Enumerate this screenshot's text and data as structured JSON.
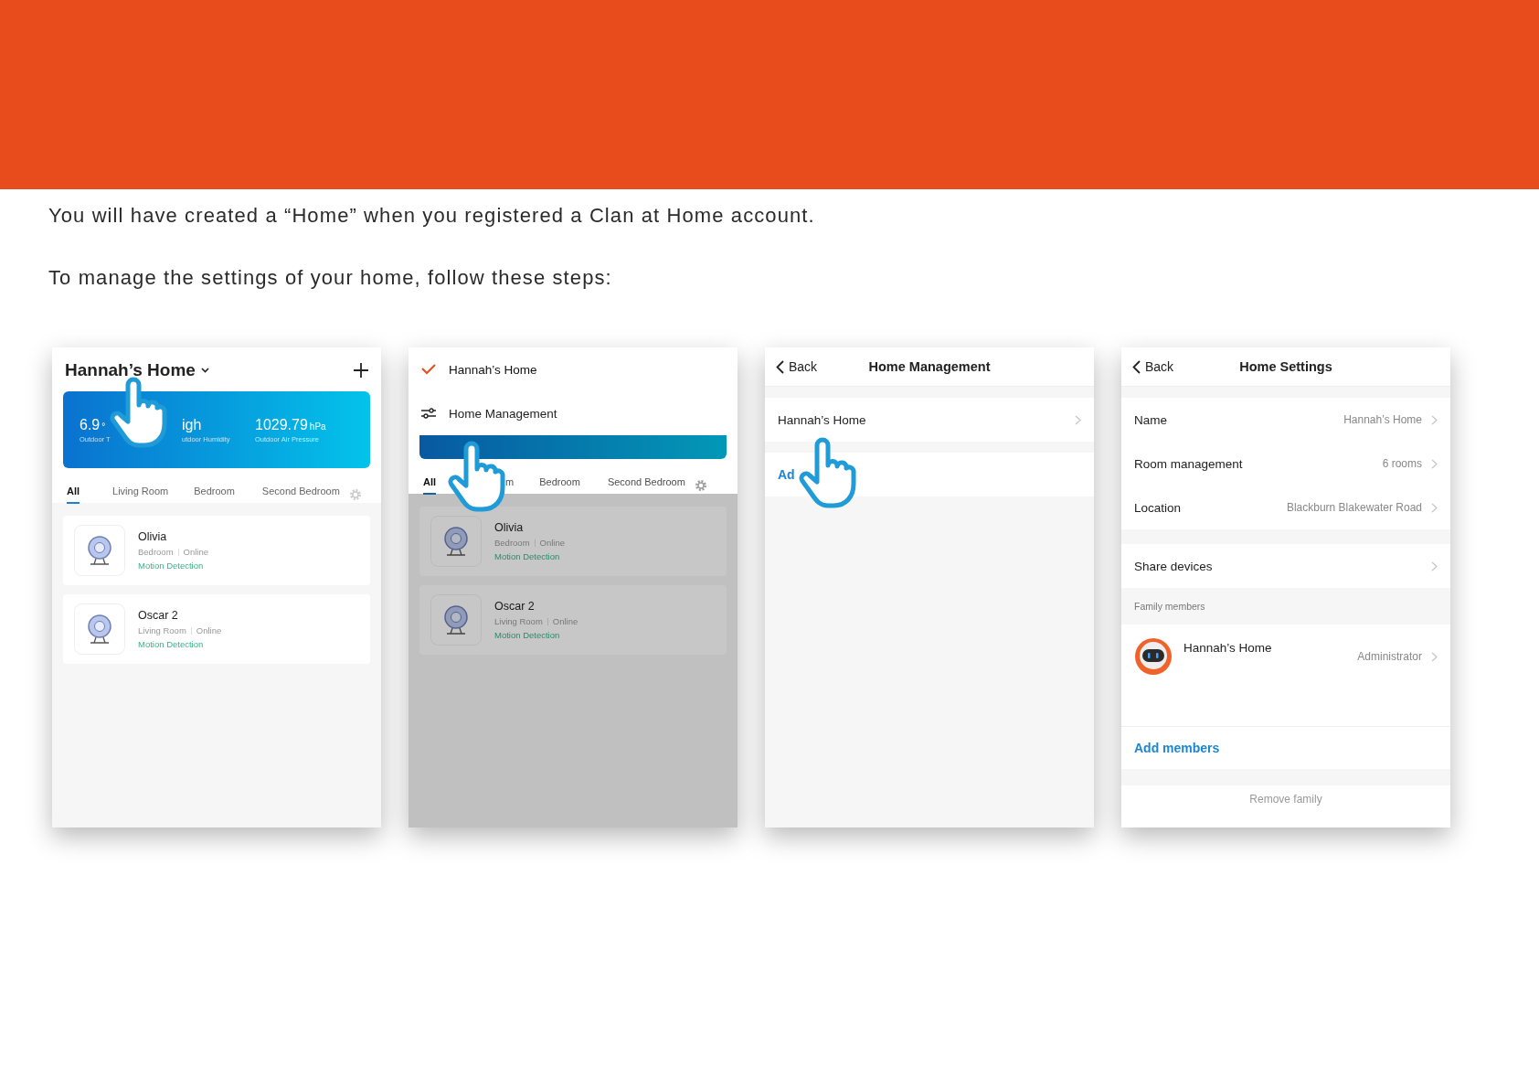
{
  "intro": [
    "You will have created a “Home” when you registered a Clan at Home account.",
    "To manage the settings of your home, follow these steps:"
  ],
  "screens": [
    {
      "kind": "home",
      "title": "Hannah’s Home",
      "weather": [
        {
          "value": "6.9",
          "unit": "°",
          "label": "Outdoor T"
        },
        {
          "value": "igh",
          "label": "utdoor Humidity"
        },
        {
          "value": "1029.79",
          "unit": "hPa",
          "label": "Outdoor Air Pressure"
        }
      ],
      "tabs": [
        {
          "label": "All",
          "selected": true
        },
        {
          "label": "Living Room",
          "selected": false
        },
        {
          "label": "Bedroom",
          "selected": false
        },
        {
          "label": "Second Bedroom",
          "selected": false
        }
      ],
      "devices": [
        {
          "name": "Olivia",
          "room": "Bedroom",
          "status": "Online",
          "mode": "Motion Detection"
        },
        {
          "name": "Oscar 2",
          "room": "Living Room",
          "status": "Online",
          "mode": "Motion Detection"
        }
      ]
    },
    {
      "kind": "menu",
      "menu": [
        {
          "kind": "home",
          "label": "Hannah’s Home",
          "selected": true
        },
        {
          "kind": "action",
          "label": "Home Management",
          "selected": false
        }
      ],
      "tabs": [
        {
          "label": "All",
          "selected": true
        },
        {
          "label": "m",
          "selected": false
        },
        {
          "label": "Bedroom",
          "selected": false
        },
        {
          "label": "Second Bedroom",
          "selected": false
        }
      ],
      "devices": [
        {
          "name": "Olivia",
          "room": "Bedroom",
          "status": "Online",
          "mode": "Motion Detection"
        },
        {
          "name": "Oscar 2",
          "room": "Living Room",
          "status": "Online",
          "mode": "Motion Detection"
        }
      ]
    },
    {
      "kind": "list",
      "back": "Back",
      "title": "Home Management",
      "rows": [
        {
          "label": "Hannah’s Home"
        }
      ],
      "link": "Ad"
    },
    {
      "kind": "settings",
      "back": "Back",
      "title": "Home Settings",
      "rows": [
        {
          "label": "Name",
          "value": "Hannah’s Home"
        },
        {
          "label": "Room management",
          "value": "6 rooms"
        },
        {
          "label": "Location",
          "value": "Blackburn Blakewater Road"
        }
      ],
      "share": "Share devices",
      "section": "Family members",
      "member": {
        "name": "Hannah’s Home",
        "role": "Administrator"
      },
      "add": "Add members",
      "remove": "Remove family"
    }
  ]
}
